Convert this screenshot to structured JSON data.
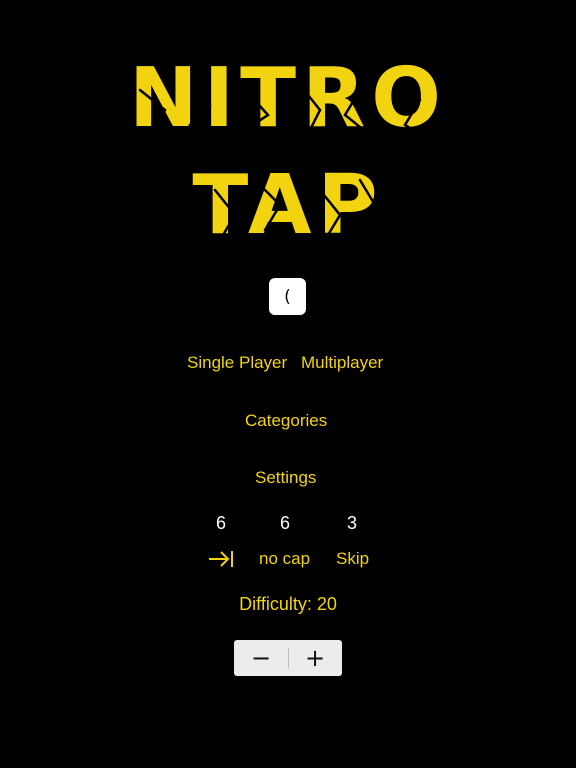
{
  "title": {
    "line1": "NITRO",
    "line2": "TAP"
  },
  "key_box": {
    "label": "("
  },
  "menu": {
    "single_player": "Single Player",
    "multiplayer": "Multiplayer",
    "categories": "Categories",
    "settings": "Settings"
  },
  "stats": [
    {
      "value": "6",
      "label_icon": "tab-to-end-icon"
    },
    {
      "value": "6",
      "label": "no cap"
    },
    {
      "value": "3",
      "label": "Skip"
    }
  ],
  "difficulty": {
    "label": "Difficulty: 20"
  },
  "stepper": {
    "minus": "−",
    "plus": "+"
  },
  "colors": {
    "background": "#000000",
    "accent": "#f2d30f",
    "text_white": "#ffffff"
  }
}
